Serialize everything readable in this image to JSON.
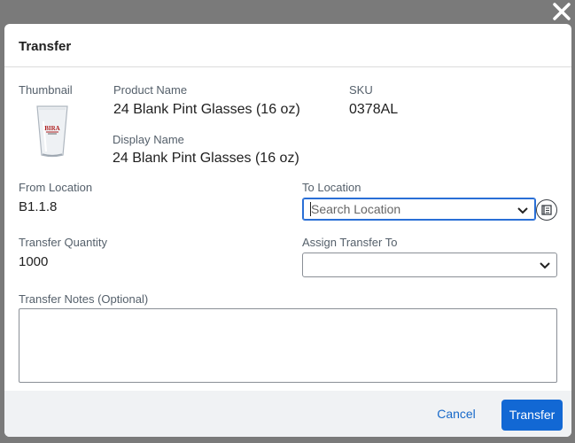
{
  "dialog": {
    "title": "Transfer",
    "close_icon": "close-icon"
  },
  "product": {
    "thumbnail_label": "Thumbnail",
    "thumbnail_icon": "pint-glass-image",
    "name_label": "Product Name",
    "name_value": "24 Blank Pint Glasses (16 oz)",
    "sku_label": "SKU",
    "sku_value": "0378AL",
    "display_name_label": "Display Name",
    "display_name_value": "24 Blank Pint Glasses (16 oz)"
  },
  "from_location": {
    "label": "From Location",
    "value": "B1.1.8"
  },
  "to_location": {
    "label": "To Location",
    "placeholder": "Search Location",
    "value": ""
  },
  "transfer_quantity": {
    "label": "Transfer Quantity",
    "value": "1000"
  },
  "assign_transfer_to": {
    "label": "Assign Transfer To",
    "value": ""
  },
  "transfer_notes": {
    "label": "Transfer Notes (Optional)",
    "value": ""
  },
  "footer": {
    "cancel_label": "Cancel",
    "submit_label": "Transfer"
  },
  "colors": {
    "overlay": "#7a7a7a",
    "primary": "#1268d4",
    "link": "#1769c9",
    "focus_border": "#2a6fd6",
    "footer_bg": "#f0f2f4"
  }
}
